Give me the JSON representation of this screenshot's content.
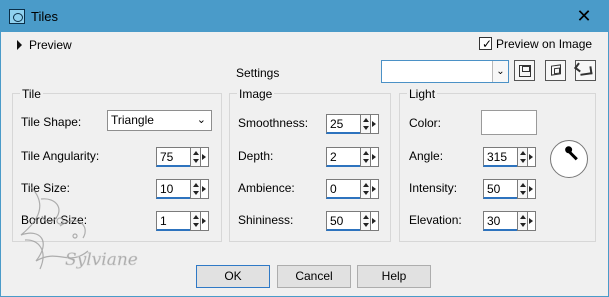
{
  "window": {
    "title": "Tiles",
    "close_glyph": "✕",
    "colors": {
      "titlebar": "#4a9bc9",
      "dialog_bg": "#f0f0f0",
      "focus_blue": "#2d73be"
    }
  },
  "top": {
    "preview_label": "Preview",
    "preview_on_image_label": "Preview on Image",
    "preview_on_image_checked": true,
    "settings_label": "Settings",
    "preset_value": "",
    "tool_icons": [
      "save-icon",
      "random-cube-icon",
      "reset-icon"
    ]
  },
  "tile": {
    "label": "Tile",
    "shape_label": "Tile Shape:",
    "shape_value": "Triangle",
    "angularity_label": "Tile Angularity:",
    "angularity_value": "75",
    "size_label": "Tile Size:",
    "size_value": "10",
    "border_label": "Border Size:",
    "border_value": "1"
  },
  "image": {
    "label": "Image",
    "smoothness_label": "Smoothness:",
    "smoothness_value": "25",
    "depth_label": "Depth:",
    "depth_value": "2",
    "ambience_label": "Ambience:",
    "ambience_value": "0",
    "shininess_label": "Shininess:",
    "shininess_value": "50"
  },
  "light": {
    "label": "Light",
    "color_label": "Color:",
    "color_value": "#ffffff",
    "angle_label": "Angle:",
    "angle_value": "315",
    "intensity_label": "Intensity:",
    "intensity_value": "50",
    "elevation_label": "Elevation:",
    "elevation_value": "30"
  },
  "buttons": {
    "ok": "OK",
    "cancel": "Cancel",
    "help": "Help"
  },
  "watermark": {
    "text": "Sylviane"
  }
}
